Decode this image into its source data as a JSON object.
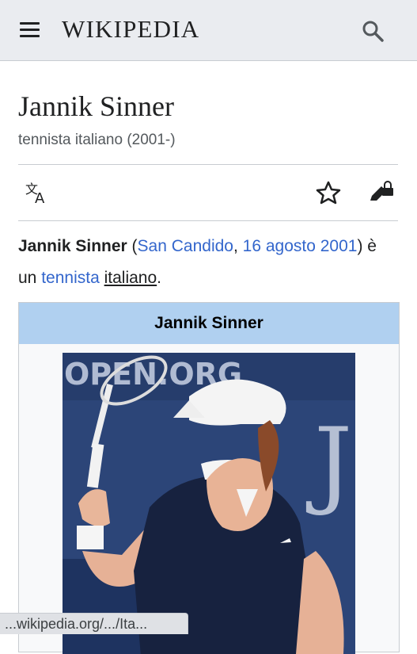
{
  "header": {
    "wordmark": "WIKIPEDIA",
    "menu_icon": "hamburger-menu-icon",
    "search_icon": "search-icon"
  },
  "page": {
    "title": "Jannik Sinner",
    "subtitle": "tennista italiano (2001-)"
  },
  "actions": {
    "language_icon": "language-translate-icon",
    "watch_icon": "star-icon",
    "edit_icon": "edit-locked-icon"
  },
  "lead": {
    "bold_name": "Jannik Sinner",
    "open_paren": " (",
    "birthplace_link": "San Candido",
    "comma": ", ",
    "date_link": "16 agosto",
    "year_link": "2001",
    "close_text": ") è un ",
    "profession_link": "tennista",
    "space": " ",
    "nationality_link": "italiano",
    "period": "."
  },
  "infobox": {
    "title": "Jannik Sinner",
    "header_color": "#b0d0f0",
    "photo_banner_text": "OPEN.ORG"
  },
  "status_bar": {
    "url": "...wikipedia.org/.../Ita..."
  },
  "colors": {
    "link": "#3366cc",
    "header_bg": "#eaecf0"
  }
}
